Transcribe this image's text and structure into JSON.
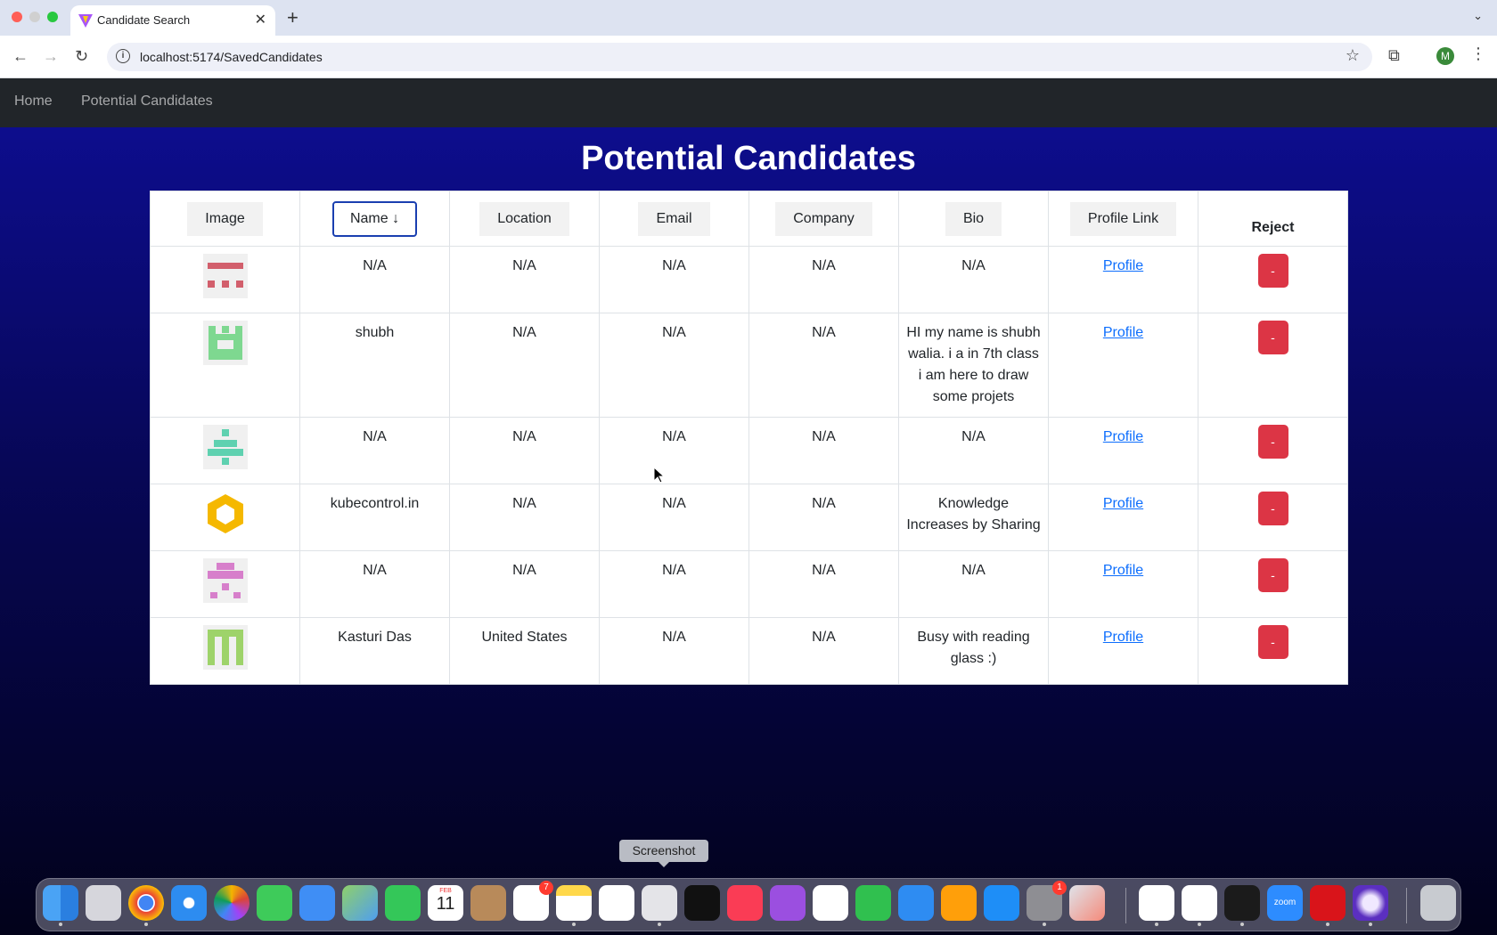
{
  "browser": {
    "tab_title": "Candidate Search",
    "url": "localhost:5174/SavedCandidates",
    "profile_initial": "M"
  },
  "nav": {
    "home": "Home",
    "potential": "Potential Candidates"
  },
  "page": {
    "title": "Potential Candidates"
  },
  "table": {
    "headers": {
      "image": "Image",
      "name": "Name ↓",
      "location": "Location",
      "email": "Email",
      "company": "Company",
      "bio": "Bio",
      "profile": "Profile Link",
      "reject": "Reject"
    },
    "rows": [
      {
        "name": "N/A",
        "location": "N/A",
        "email": "N/A",
        "company": "N/A",
        "bio": "N/A",
        "profile": "Profile",
        "reject": "-",
        "avatar": "identicon-red"
      },
      {
        "name": "shubh",
        "location": "N/A",
        "email": "N/A",
        "company": "N/A",
        "bio": "HI my name is shubh walia. i a in 7th class i am here to draw some projets",
        "profile": "Profile",
        "reject": "-",
        "avatar": "identicon-green"
      },
      {
        "name": "N/A",
        "location": "N/A",
        "email": "N/A",
        "company": "N/A",
        "bio": "N/A",
        "profile": "Profile",
        "reject": "-",
        "avatar": "identicon-teal"
      },
      {
        "name": "kubecontrol.in",
        "location": "N/A",
        "email": "N/A",
        "company": "N/A",
        "bio": "Knowledge Increases by Sharing",
        "profile": "Profile",
        "reject": "-",
        "avatar": "hexagon-logo"
      },
      {
        "name": "N/A",
        "location": "N/A",
        "email": "N/A",
        "company": "N/A",
        "bio": "N/A",
        "profile": "Profile",
        "reject": "-",
        "avatar": "identicon-pink"
      },
      {
        "name": "Kasturi Das",
        "location": "United States",
        "email": "N/A",
        "company": "N/A",
        "bio": "Busy with reading glass :)",
        "profile": "Profile",
        "reject": "-",
        "avatar": "identicon-lime"
      }
    ]
  },
  "dock": {
    "tooltip": "Screenshot",
    "calendar_month": "FEB",
    "calendar_day": "11",
    "reminders_badge": "7",
    "settings_badge": "1",
    "zoom_label": "zoom"
  },
  "colors": {
    "reject": "#dc3545",
    "link": "#0d6efd",
    "navbar": "#212529"
  }
}
